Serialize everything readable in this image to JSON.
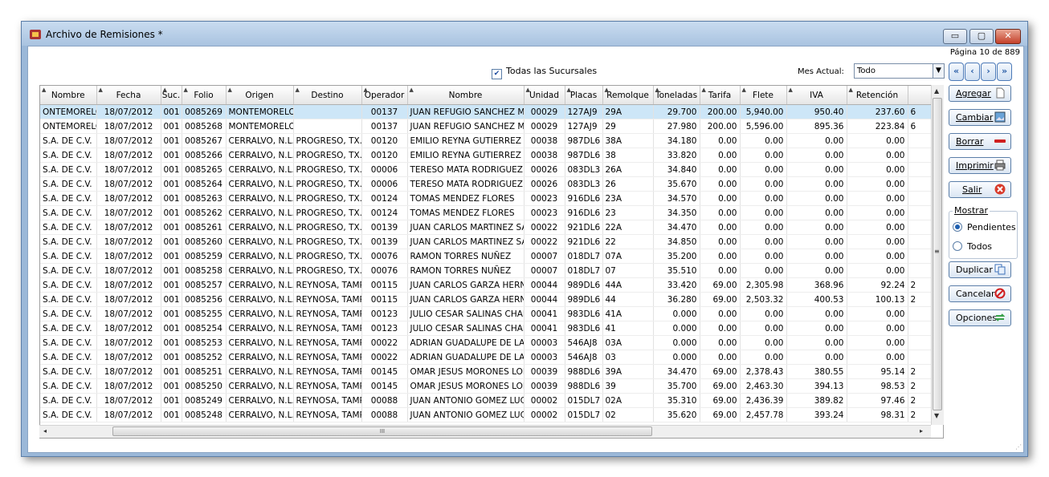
{
  "window": {
    "title": "Archivo de Remisiones *",
    "controls": {
      "minimize": "▭",
      "maximize": "▢",
      "close": "✕"
    }
  },
  "pagination": {
    "label": "Página 10 de 889"
  },
  "filters": {
    "todas_label": "Todas las Sucursales",
    "todas_checked": true,
    "mes_label": "Mes Actual:",
    "mes_value": "Todo"
  },
  "table": {
    "columns": [
      "Nombre",
      "Fecha",
      "Suc.",
      "Folio",
      "Origen",
      "Destino",
      "Operador",
      "Nombre",
      "Unidad",
      "Placas",
      "Remolque",
      "Toneladas",
      "Tarifa",
      "Flete",
      "IVA",
      "Retención",
      ""
    ],
    "rows": [
      [
        "ONTEMORELOS",
        "18/07/2012",
        "001",
        "0085269",
        "MONTEMORELOS",
        "",
        "00137",
        "JUAN REFUGIO SANCHEZ MEDINA",
        "00029",
        "127AJ9",
        "29A",
        "29.700",
        "200.00",
        "5,940.00",
        "950.40",
        "237.60",
        "6"
      ],
      [
        "ONTEMORELOS",
        "18/07/2012",
        "001",
        "0085268",
        "MONTEMORELOS",
        "",
        "00137",
        "JUAN REFUGIO SANCHEZ MEDINA",
        "00029",
        "127AJ9",
        "29",
        "27.980",
        "200.00",
        "5,596.00",
        "895.36",
        "223.84",
        "6"
      ],
      [
        "S.A. DE C.V.",
        "18/07/2012",
        "001",
        "0085267",
        "CERRALVO, N.L.",
        "PROGRESO, TX.",
        "00120",
        "EMILIO REYNA GUTIERREZ",
        "00038",
        "987DL6",
        "38A",
        "34.180",
        "0.00",
        "0.00",
        "0.00",
        "0.00",
        ""
      ],
      [
        "S.A. DE C.V.",
        "18/07/2012",
        "001",
        "0085266",
        "CERRALVO, N.L.",
        "PROGRESO, TX.",
        "00120",
        "EMILIO REYNA GUTIERREZ",
        "00038",
        "987DL6",
        "38",
        "33.820",
        "0.00",
        "0.00",
        "0.00",
        "0.00",
        ""
      ],
      [
        "S.A. DE C.V.",
        "18/07/2012",
        "001",
        "0085265",
        "CERRALVO, N.L.",
        "PROGRESO, TX.",
        "00006",
        "TERESO MATA RODRIGUEZ",
        "00026",
        "083DL3",
        "26A",
        "34.840",
        "0.00",
        "0.00",
        "0.00",
        "0.00",
        ""
      ],
      [
        "S.A. DE C.V.",
        "18/07/2012",
        "001",
        "0085264",
        "CERRALVO, N.L.",
        "PROGRESO, TX.",
        "00006",
        "TERESO MATA RODRIGUEZ",
        "00026",
        "083DL3",
        "26",
        "35.670",
        "0.00",
        "0.00",
        "0.00",
        "0.00",
        ""
      ],
      [
        "S.A. DE C.V.",
        "18/07/2012",
        "001",
        "0085263",
        "CERRALVO, N.L.",
        "PROGRESO, TX.",
        "00124",
        "TOMAS MENDEZ FLORES",
        "00023",
        "916DL6",
        "23A",
        "34.570",
        "0.00",
        "0.00",
        "0.00",
        "0.00",
        ""
      ],
      [
        "S.A. DE C.V.",
        "18/07/2012",
        "001",
        "0085262",
        "CERRALVO, N.L.",
        "PROGRESO, TX.",
        "00124",
        "TOMAS MENDEZ FLORES",
        "00023",
        "916DL6",
        "23",
        "34.350",
        "0.00",
        "0.00",
        "0.00",
        "0.00",
        ""
      ],
      [
        "S.A. DE C.V.",
        "18/07/2012",
        "001",
        "0085261",
        "CERRALVO, N.L.",
        "PROGRESO, TX.",
        "00139",
        "JUAN CARLOS MARTINEZ SANTOS",
        "00022",
        "921DL6",
        "22A",
        "34.470",
        "0.00",
        "0.00",
        "0.00",
        "0.00",
        ""
      ],
      [
        "S.A. DE C.V.",
        "18/07/2012",
        "001",
        "0085260",
        "CERRALVO, N.L.",
        "PROGRESO, TX.",
        "00139",
        "JUAN CARLOS MARTINEZ SANTOS",
        "00022",
        "921DL6",
        "22",
        "34.850",
        "0.00",
        "0.00",
        "0.00",
        "0.00",
        ""
      ],
      [
        "S.A. DE C.V.",
        "18/07/2012",
        "001",
        "0085259",
        "CERRALVO, N.L.",
        "PROGRESO, TX.",
        "00076",
        "RAMON TORRES NUÑEZ",
        "00007",
        "018DL7",
        "07A",
        "35.200",
        "0.00",
        "0.00",
        "0.00",
        "0.00",
        ""
      ],
      [
        "S.A. DE C.V.",
        "18/07/2012",
        "001",
        "0085258",
        "CERRALVO, N.L.",
        "PROGRESO, TX.",
        "00076",
        "RAMON TORRES NUÑEZ",
        "00007",
        "018DL7",
        "07",
        "35.510",
        "0.00",
        "0.00",
        "0.00",
        "0.00",
        ""
      ],
      [
        "S.A. DE C.V.",
        "18/07/2012",
        "001",
        "0085257",
        "CERRALVO, N.L.",
        "REYNOSA, TAMPS.",
        "00115",
        "JUAN CARLOS GARZA HERNANDEZ",
        "00044",
        "989DL6",
        "44A",
        "33.420",
        "69.00",
        "2,305.98",
        "368.96",
        "92.24",
        "2"
      ],
      [
        "S.A. DE C.V.",
        "18/07/2012",
        "001",
        "0085256",
        "CERRALVO, N.L.",
        "REYNOSA, TAMPS.",
        "00115",
        "JUAN CARLOS GARZA HERNANDEZ",
        "00044",
        "989DL6",
        "44",
        "36.280",
        "69.00",
        "2,503.32",
        "400.53",
        "100.13",
        "2"
      ],
      [
        "S.A. DE C.V.",
        "18/07/2012",
        "001",
        "0085255",
        "CERRALVO, N.L.",
        "REYNOSA, TAMPS.",
        "00123",
        "JULIO CESAR SALINAS CHAPA",
        "00041",
        "983DL6",
        "41A",
        "0.000",
        "0.00",
        "0.00",
        "0.00",
        "0.00",
        ""
      ],
      [
        "S.A. DE C.V.",
        "18/07/2012",
        "001",
        "0085254",
        "CERRALVO, N.L.",
        "REYNOSA, TAMPS.",
        "00123",
        "JULIO CESAR SALINAS CHAPA",
        "00041",
        "983DL6",
        "41",
        "0.000",
        "0.00",
        "0.00",
        "0.00",
        "0.00",
        ""
      ],
      [
        "S.A. DE C.V.",
        "18/07/2012",
        "001",
        "0085253",
        "CERRALVO, N.L.",
        "REYNOSA, TAMPS.",
        "00022",
        "ADRIAN GUADALUPE DE LA GARZA",
        "00003",
        "546AJ8",
        "03A",
        "0.000",
        "0.00",
        "0.00",
        "0.00",
        "0.00",
        ""
      ],
      [
        "S.A. DE C.V.",
        "18/07/2012",
        "001",
        "0085252",
        "CERRALVO, N.L.",
        "REYNOSA, TAMPS.",
        "00022",
        "ADRIAN GUADALUPE DE LA GARZA",
        "00003",
        "546AJ8",
        "03",
        "0.000",
        "0.00",
        "0.00",
        "0.00",
        "0.00",
        ""
      ],
      [
        "S.A. DE C.V.",
        "18/07/2012",
        "001",
        "0085251",
        "CERRALVO, N.L.",
        "REYNOSA, TAMPS.",
        "00145",
        "OMAR JESUS MORONES LOPEZ",
        "00039",
        "988DL6",
        "39A",
        "34.470",
        "69.00",
        "2,378.43",
        "380.55",
        "95.14",
        "2"
      ],
      [
        "S.A. DE C.V.",
        "18/07/2012",
        "001",
        "0085250",
        "CERRALVO, N.L.",
        "REYNOSA, TAMPS.",
        "00145",
        "OMAR JESUS MORONES LOPEZ",
        "00039",
        "988DL6",
        "39",
        "35.700",
        "69.00",
        "2,463.30",
        "394.13",
        "98.53",
        "2"
      ],
      [
        "S.A. DE C.V.",
        "18/07/2012",
        "001",
        "0085249",
        "CERRALVO, N.L.",
        "REYNOSA, TAMPS.",
        "00088",
        "JUAN ANTONIO GOMEZ LUCIO",
        "00002",
        "015DL7",
        "02A",
        "35.310",
        "69.00",
        "2,436.39",
        "389.82",
        "97.46",
        "2"
      ],
      [
        "S.A. DE C.V.",
        "18/07/2012",
        "001",
        "0085248",
        "CERRALVO, N.L.",
        "REYNOSA, TAMPS.",
        "00088",
        "JUAN ANTONIO GOMEZ LUCIO",
        "00002",
        "015DL7",
        "02",
        "35.620",
        "69.00",
        "2,457.78",
        "393.24",
        "98.31",
        "2"
      ]
    ]
  },
  "scroll": {
    "hthumb_label": "III",
    "up": "▲",
    "down": "▼",
    "left": "◂",
    "right": "▸",
    "mid": "≡",
    "grip": "⋰"
  },
  "sidebar": {
    "agregar": "Agregar",
    "cambiar": "Cambiar",
    "borrar": "Borrar",
    "imprimir": "Imprimir",
    "salir": "Salir",
    "mostrar_label": "Mostrar",
    "pendientes": "Pendientes",
    "todos": "Todos",
    "pendientes_selected": true,
    "duplicar": "Duplicar",
    "cancelar": "Cancelar",
    "opciones": "Opciones"
  },
  "nav": {
    "first": "«",
    "prev": "‹",
    "next": "›",
    "last": "»"
  },
  "colors": {
    "selected_row": "#cde6f7",
    "accent": "#2a5fa8",
    "delete_red": "#d01f1f",
    "green": "#3aa14a"
  }
}
